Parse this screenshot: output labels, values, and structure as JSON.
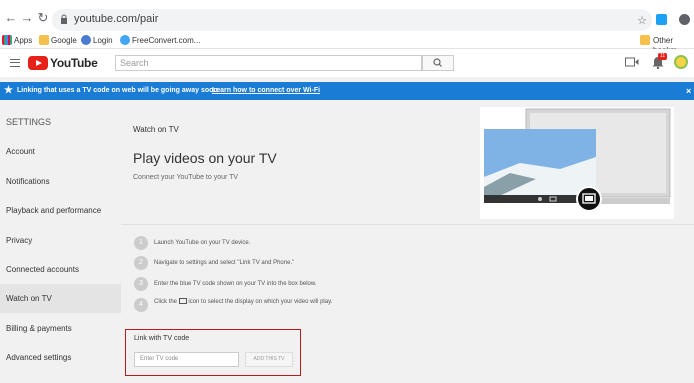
{
  "browser": {
    "url": "youtube.com/pair",
    "bookmarks": [
      {
        "label": "Apps"
      },
      {
        "label": "Google"
      },
      {
        "label": "Login"
      },
      {
        "label": "FreeConvert.com..."
      }
    ],
    "other_bookmarks": "Other bookm",
    "notification_count": "11"
  },
  "header": {
    "logo_text": "YouTube",
    "search_placeholder": "Search"
  },
  "banner": {
    "message": "Linking that uses a TV code on web will be going away soon.",
    "link": "Learn how to connect over Wi-Fi",
    "color": "#1a7cd5"
  },
  "sidebar": {
    "title": "SETTINGS",
    "items": [
      {
        "label": "Account"
      },
      {
        "label": "Notifications"
      },
      {
        "label": "Playback and performance"
      },
      {
        "label": "Privacy"
      },
      {
        "label": "Connected accounts"
      },
      {
        "label": "Watch on TV"
      },
      {
        "label": "Billing & payments"
      },
      {
        "label": "Advanced settings"
      }
    ],
    "active": "Watch on TV"
  },
  "main": {
    "section_title": "Watch on TV",
    "heading": "Play videos on your TV",
    "subheading": "Connect your YouTube to your TV",
    "steps": [
      {
        "num": "1",
        "text": "Launch YouTube on your TV device."
      },
      {
        "num": "2",
        "text": "Navigate to settings and select \"Link TV and Phone.\""
      },
      {
        "num": "3",
        "text": "Enter the blue TV code shown on your TV into the box below."
      },
      {
        "num": "4",
        "text_before": "Click the",
        "text_after": "icon to select the display on which your video will play."
      }
    ],
    "link_box": {
      "title": "Link with TV code",
      "input_placeholder": "Enter TV code",
      "button": "ADD THIS TV"
    }
  }
}
